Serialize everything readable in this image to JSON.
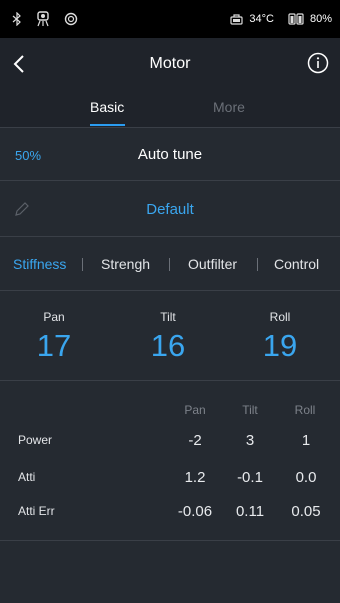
{
  "status_bar": {
    "icons": [
      "bluetooth-icon",
      "gimbal-icon",
      "sync-icon"
    ],
    "temperature": "34°C",
    "battery": "80%"
  },
  "header": {
    "title": "Motor",
    "back_icon": "chevron-left-icon",
    "info_icon": "info-icon"
  },
  "tabs": [
    {
      "label": "Basic",
      "active": true
    },
    {
      "label": "More",
      "active": false
    }
  ],
  "autotune": {
    "percent": "50%",
    "label": "Auto tune"
  },
  "preset": {
    "label": "Default",
    "icon": "pencil-icon"
  },
  "subtabs": [
    {
      "label": "Stiffness",
      "active": true
    },
    {
      "label": "Strengh",
      "active": false
    },
    {
      "label": "Outfilter",
      "active": false
    },
    {
      "label": "Control",
      "active": false
    }
  ],
  "axes": [
    {
      "label": "Pan",
      "value": "17"
    },
    {
      "label": "Tilt",
      "value": "16"
    },
    {
      "label": "Roll",
      "value": "19"
    }
  ],
  "table": {
    "headers": [
      "Pan",
      "Tilt",
      "Roll"
    ],
    "rows": [
      {
        "label": "Power",
        "values": [
          "-2",
          "3",
          "1"
        ]
      },
      {
        "label": "Atti",
        "values": [
          "1.2",
          "-0.1",
          "0.0"
        ]
      },
      {
        "label": "Atti Err",
        "values": [
          "-0.06",
          "0.11",
          "0.05"
        ]
      }
    ]
  },
  "colors": {
    "accent": "#3aa6ef",
    "background": "#252a31",
    "header": "#1f232a"
  }
}
